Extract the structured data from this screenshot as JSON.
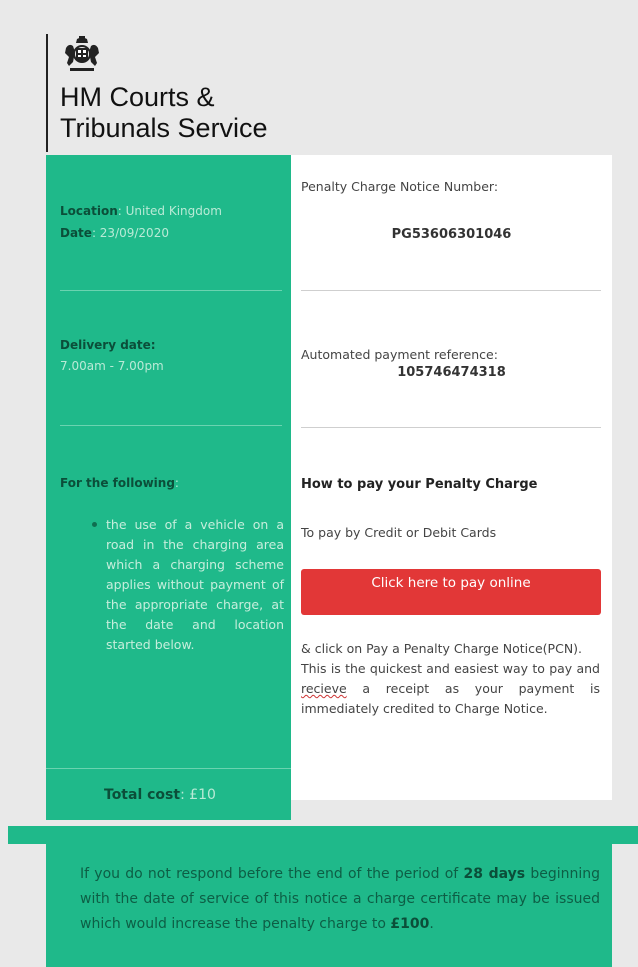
{
  "header": {
    "crest_icon": "royal-coat-of-arms-icon",
    "title_line1": "HM Courts &",
    "title_line2": "Tribunals Service"
  },
  "left": {
    "location_label": "Location",
    "location_value": ": United Kingdom",
    "date_label": "Date",
    "date_value": ": 23/09/2020",
    "delivery_label": "Delivery date:",
    "delivery_value": "7.00am - 7.00pm",
    "following_label": "For the following",
    "following_colon": ":",
    "bullet_text": "the use of a vehicle on a road in the charging area which a charging scheme applies without payment of the appropriate charge, at the date and location started below.",
    "total_label": "Total cost",
    "total_value": ": £10"
  },
  "right": {
    "pcn_label": "Penalty Charge Notice Number:",
    "pcn_value": "PG53606301046",
    "apr_label": "Automated payment reference:",
    "apr_value": "105746474318",
    "how_title": "How to pay your Penalty Charge",
    "pay_by": "To pay by Credit or Debit Cards",
    "pay_button": "Click here to pay online",
    "instr_line1": "& click on Pay a Penalty Charge Notice(PCN).",
    "instr_line2_a": "This is the quickest and easiest way to pay and ",
    "instr_line2_misspelt": "recieve",
    "instr_line2_b": " a receipt as your payment is immediately credited to Charge Notice."
  },
  "footer": {
    "text_a": "If you do not respond before the end of the period of ",
    "days": "28 days",
    "text_b": " beginning with the date of service of this notice a charge certificate may be issued which would increase the penalty charge to ",
    "amount": "£100",
    "text_c": "."
  },
  "colors": {
    "green": "#1fb98a",
    "dark_green_text": "#0d5e45",
    "red_button": "#e23737",
    "page_bg": "#e9e9e9"
  }
}
